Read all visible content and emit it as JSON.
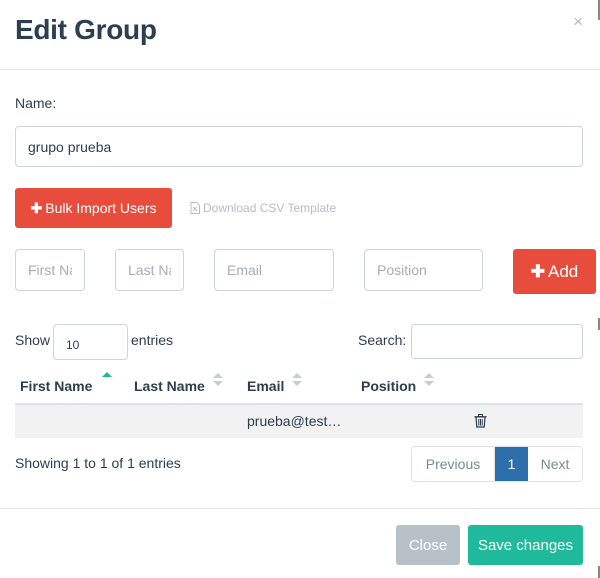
{
  "modal": {
    "title": "Edit Group",
    "close_glyph": "×"
  },
  "form": {
    "name_label": "Name:",
    "name_value": "grupo prueba",
    "bulk_import_label": "Bulk Import Users",
    "csv_template_label": "Download CSV Template",
    "first_name_placeholder": "First Name",
    "last_name_placeholder": "Last Name",
    "email_placeholder": "Email",
    "position_placeholder": "Position",
    "add_label": "Add"
  },
  "table": {
    "show_label": "Show",
    "entries_value": "10",
    "entries_label": "entries",
    "search_label": "Search:",
    "search_value": "",
    "columns": [
      "First Name",
      "Last Name",
      "Email",
      "Position"
    ],
    "rows": [
      {
        "first_name": "",
        "last_name": "",
        "email": "prueba@test…",
        "position": ""
      }
    ],
    "info": "Showing 1 to 1 of 1 entries",
    "pagination": {
      "previous": "Previous",
      "current": "1",
      "next": "Next"
    }
  },
  "footer": {
    "close_label": "Close",
    "save_label": "Save changes"
  },
  "icons": {
    "plus": "plus-icon",
    "file": "file-icon",
    "trash": "trash-icon",
    "sort": "sort-icon"
  },
  "colors": {
    "danger": "#e74c3c",
    "success": "#1fba9c",
    "primary": "#2c6faa",
    "muted": "#b8c0c8",
    "text": "#2c3e50"
  }
}
